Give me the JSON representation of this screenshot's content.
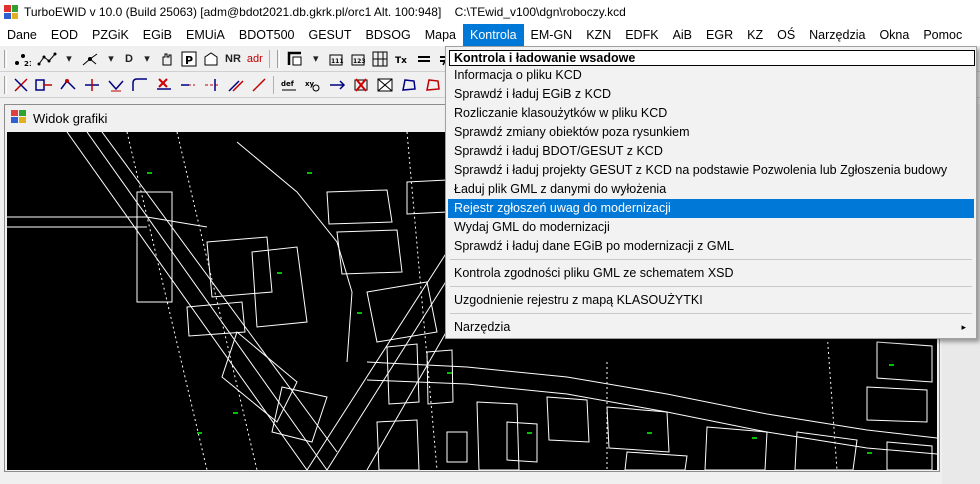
{
  "window": {
    "title": "TurboEWID v 10.0 (Build 25063) [adm@bdot2021.db.gkrk.pl/orc1 Alt. 100:948]    C:\\TEwid_v100\\dgn\\roboczy.kcd"
  },
  "menubar": {
    "items": [
      "Dane",
      "EOD",
      "PZGiK",
      "EGiB",
      "EMUiA",
      "BDOT500",
      "GESUT",
      "BDSOG",
      "Mapa",
      "Kontrola",
      "EM-GN",
      "KZN",
      "EDFK",
      "AiB",
      "EGR",
      "KZ",
      "OŚ",
      "Narzędzia",
      "Okna",
      "Pomoc"
    ],
    "active": "Kontrola"
  },
  "toolbar1": {
    "d_label": "D",
    "nr_label": "NR",
    "adr_label": "adr"
  },
  "graphics_window": {
    "title": "Widok grafiki"
  },
  "dropdown": {
    "header": "Kontrola i ładowanie wsadowe",
    "items": [
      "Informacja o pliku KCD",
      "Sprawdź i ładuj EGiB z KCD",
      "Rozliczanie klasoużytków w pliku KCD",
      "Sprawdź zmiany obiektów poza rysunkiem",
      "Sprawdź i ładuj BDOT/GESUT z KCD",
      "Sprawdź i ładuj projekty GESUT z KCD na podstawie Pozwolenia lub Zgłoszenia budowy",
      "Ładuj plik GML z danymi do wyłożenia",
      "Rejestr zgłoszeń uwag do modernizacji",
      "Wydaj GML do modernizacji",
      "Sprawdź i ładuj dane EGiB po modernizacji z GML",
      "Kontrola zgodności pliku GML ze schematem XSD",
      "Uzgodnienie rejestru z mapą KLASOUŻYTKI",
      "Narzędzia"
    ],
    "highlighted_index": 7,
    "submenu_arrow": "▸"
  },
  "colors": {
    "highlight": "#0078d7",
    "canvas_bg": "#000000",
    "map_lines": "#ffffff",
    "map_labels": "#00c000"
  }
}
